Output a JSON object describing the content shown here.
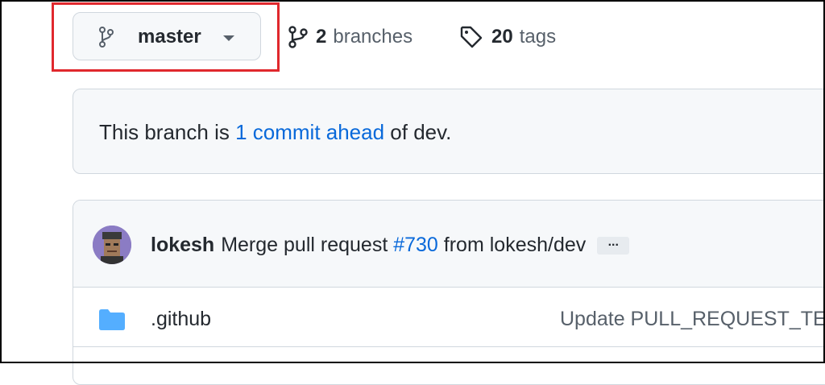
{
  "branch_selector": {
    "current_branch": "master",
    "icon": "git-branch-icon"
  },
  "repo_meta": {
    "branches_count": "2",
    "branches_label": "branches",
    "tags_count": "20",
    "tags_label": "tags"
  },
  "ahead_banner": {
    "prefix": "This branch is ",
    "link_text": "1 commit ahead",
    "suffix": " of dev."
  },
  "latest_commit": {
    "author": "lokesh",
    "message_prefix": "Merge pull request ",
    "pr_link": "#730",
    "message_suffix": " from lokesh/dev",
    "more_label": "..."
  },
  "files": [
    {
      "icon": "folder-icon",
      "name": ".github",
      "last_commit": "Update PULL_REQUEST_TEMPLATE"
    }
  ],
  "colors": {
    "highlight": "#e0282d",
    "link": "#0969da",
    "folder": "#54aeff"
  }
}
